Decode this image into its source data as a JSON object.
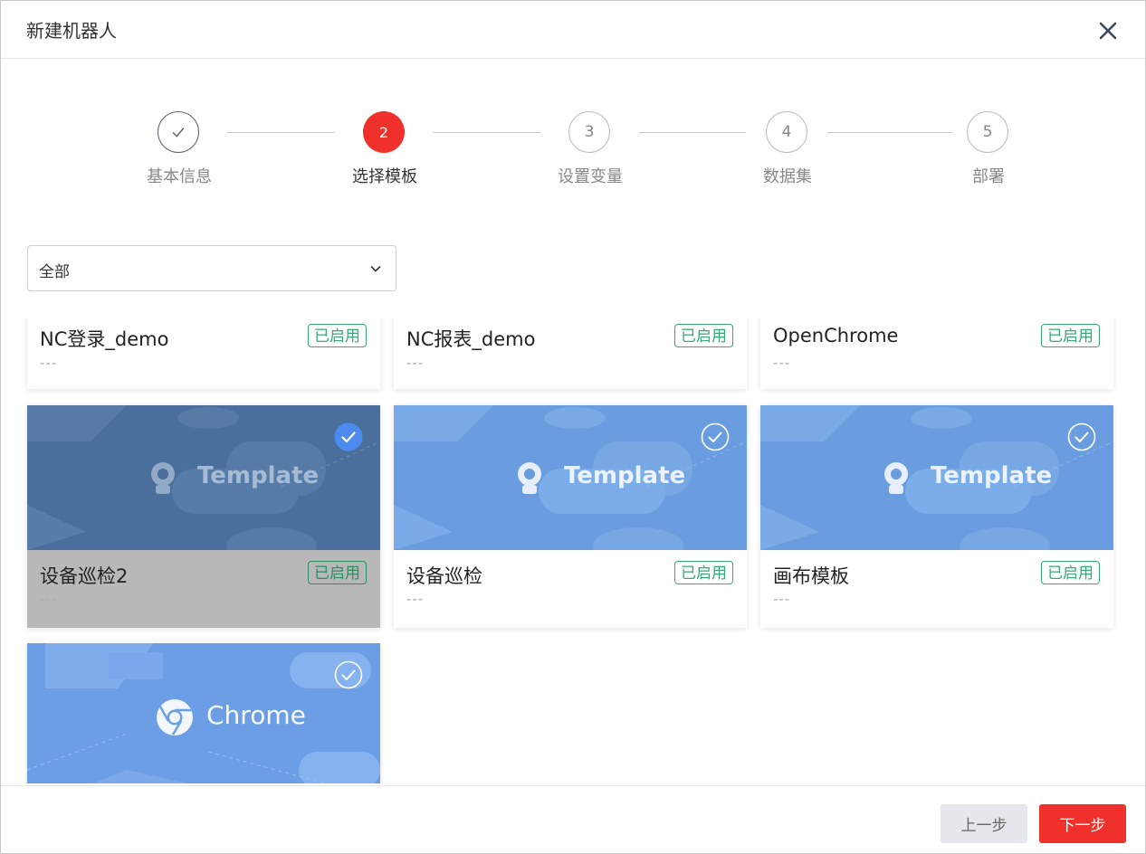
{
  "dialog": {
    "title": "新建机器人"
  },
  "steps": [
    {
      "number": "",
      "label": "基本信息",
      "state": "done"
    },
    {
      "number": "2",
      "label": "选择模板",
      "state": "active"
    },
    {
      "number": "3",
      "label": "设置变量",
      "state": "pending"
    },
    {
      "number": "4",
      "label": "数据集",
      "state": "pending"
    },
    {
      "number": "5",
      "label": "部署",
      "state": "pending"
    }
  ],
  "filter": {
    "value": "全部"
  },
  "cards": [
    {
      "name": "NC登录_demo",
      "desc": "---",
      "badge": "已启用"
    },
    {
      "name": "NC报表_demo",
      "desc": "---",
      "badge": "已启用"
    },
    {
      "name": "OpenChrome",
      "desc": "---",
      "badge": "已启用"
    },
    {
      "name": "设备巡检2",
      "desc": "---",
      "badge": "已启用",
      "thumb_text": "Template",
      "selected": true
    },
    {
      "name": "设备巡检",
      "desc": "---",
      "badge": "已启用",
      "thumb_text": "Template"
    },
    {
      "name": "画布模板",
      "desc": "---",
      "badge": "已启用",
      "thumb_text": "Template"
    },
    {
      "thumb_text": "Chrome"
    }
  ],
  "footer": {
    "prev_label": "上一步",
    "next_label": "下一步"
  },
  "colors": {
    "accent": "#f0302a",
    "badge_green": "#36a974",
    "thumb_blue": "#6a9de0",
    "thumb_selected": "#4a6f9c"
  }
}
